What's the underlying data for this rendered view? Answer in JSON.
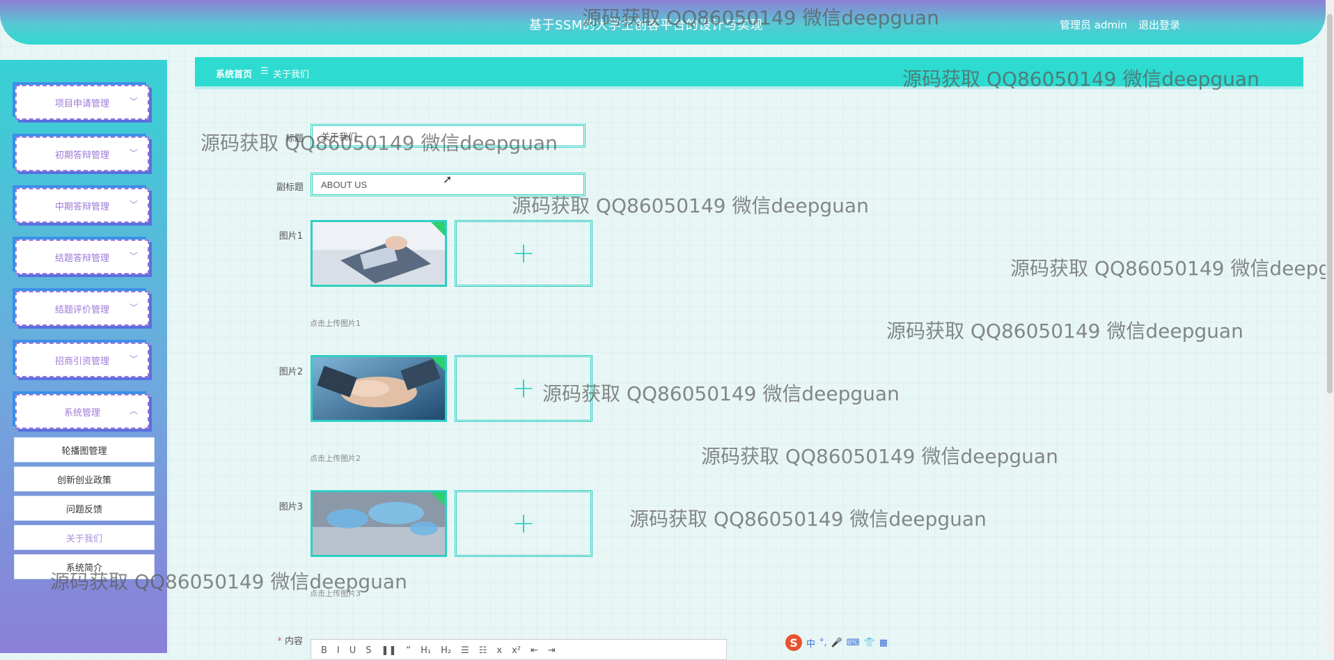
{
  "header": {
    "title": "基于SSM的大学生创客平台的设计与实现",
    "user": "管理员 admin",
    "logout": "退出登录"
  },
  "sidebar": {
    "menus": [
      {
        "label": "项目申请管理",
        "icon": "chevron-down-icon"
      },
      {
        "label": "初期答辩管理",
        "icon": "chevron-down-icon"
      },
      {
        "label": "中期答辩管理",
        "icon": "chevron-down-icon"
      },
      {
        "label": "结题答辩管理",
        "icon": "chevron-down-icon"
      },
      {
        "label": "结题评价管理",
        "icon": "chevron-down-icon"
      },
      {
        "label": "招商引资管理",
        "icon": "chevron-down-icon"
      },
      {
        "label": "系统管理",
        "icon": "chevron-up-icon"
      }
    ],
    "submenu": [
      {
        "label": "轮播图管理"
      },
      {
        "label": "创新创业政策"
      },
      {
        "label": "问题反馈"
      },
      {
        "label": "关于我们",
        "active": true
      },
      {
        "label": "系统简介"
      }
    ]
  },
  "breadcrumb": {
    "home": "系统首页",
    "separator": "☰",
    "current": "关于我们"
  },
  "form": {
    "title_label": "标题",
    "title_value": "关于我们",
    "subtitle_label": "副标题",
    "subtitle_value": "ABOUT US",
    "images": [
      {
        "label": "图片1",
        "hint": "点击上传图片1"
      },
      {
        "label": "图片2",
        "hint": "点击上传图片2"
      },
      {
        "label": "图片3",
        "hint": "点击上传图片3"
      }
    ],
    "upload_plus": "+",
    "content_required": "*",
    "content_label": "内容"
  },
  "editor_toolbar": [
    "B",
    "I",
    "U",
    "S",
    "❚❚",
    "“",
    "H₁",
    "H₂",
    "☰",
    "☷",
    "x",
    "x²",
    "⇤",
    "⇥"
  ],
  "ime": {
    "logo": "S",
    "lang": "中",
    "punct": "°,"
  },
  "watermark": "源码获取 QQ86050149 微信deepguan",
  "colors": {
    "accent": "#2ddbd0",
    "purple": "#9c79d8"
  }
}
